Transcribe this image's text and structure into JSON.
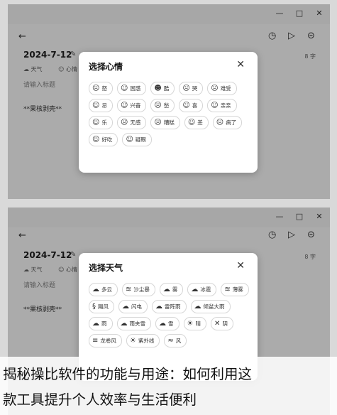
{
  "window_controls": {
    "minimize": "—",
    "maximize": "□",
    "close": "✕"
  },
  "note": {
    "date": "2024-7-12",
    "char_count": "8 字",
    "weather_label": "天气",
    "mood_label": "心情",
    "title_placeholder": "请输入标题",
    "body_text": "**果核剥壳**"
  },
  "mood_dialog": {
    "title": "选择心情",
    "close": "✕",
    "items": [
      {
        "icon": "☹",
        "label": "怒"
      },
      {
        "icon": "☺",
        "label": "困惑"
      },
      {
        "icon": "☻",
        "label": "酷"
      },
      {
        "icon": "☹",
        "label": "哭"
      },
      {
        "icon": "☹",
        "label": "难受"
      },
      {
        "icon": "☺",
        "label": "忌"
      },
      {
        "icon": "☺",
        "label": "兴奋"
      },
      {
        "icon": "☹",
        "label": "愁"
      },
      {
        "icon": "☺",
        "label": "喜"
      },
      {
        "icon": "☺",
        "label": "亲亲"
      },
      {
        "icon": "☺",
        "label": "乐"
      },
      {
        "icon": "☹",
        "label": "无感"
      },
      {
        "icon": "☹",
        "label": "糟糕"
      },
      {
        "icon": "☺",
        "label": "恙"
      },
      {
        "icon": "☹",
        "label": "病了"
      },
      {
        "icon": "☺",
        "label": "好吃"
      },
      {
        "icon": "☺",
        "label": "疑眼"
      }
    ]
  },
  "weather_dialog": {
    "title": "选择天气",
    "close": "✕",
    "items": [
      {
        "icon": "☁",
        "label": "多云"
      },
      {
        "icon": "≋",
        "label": "沙尘暴"
      },
      {
        "icon": "☁",
        "label": "雾"
      },
      {
        "icon": "☁",
        "label": "冰雹"
      },
      {
        "icon": "≋",
        "label": "薄雾"
      },
      {
        "icon": "§",
        "label": "飓风"
      },
      {
        "icon": "☁",
        "label": "闪电"
      },
      {
        "icon": "☁",
        "label": "雷阵雨"
      },
      {
        "icon": "☁",
        "label": "倾盆大雨"
      },
      {
        "icon": "☁",
        "label": "雨"
      },
      {
        "icon": "☁",
        "label": "雨夹雪"
      },
      {
        "icon": "☁",
        "label": "雪"
      },
      {
        "icon": "☀",
        "label": "晴"
      },
      {
        "icon": "✕",
        "label": "阴"
      },
      {
        "icon": "≡",
        "label": "龙卷风"
      },
      {
        "icon": "☀",
        "label": "紫外线"
      },
      {
        "icon": "≈",
        "label": "风"
      }
    ]
  },
  "caption": {
    "line1": "揭秘操比软件的功能与用途：如何利用这",
    "line2": "款工具提升个人效率与生活便利"
  }
}
